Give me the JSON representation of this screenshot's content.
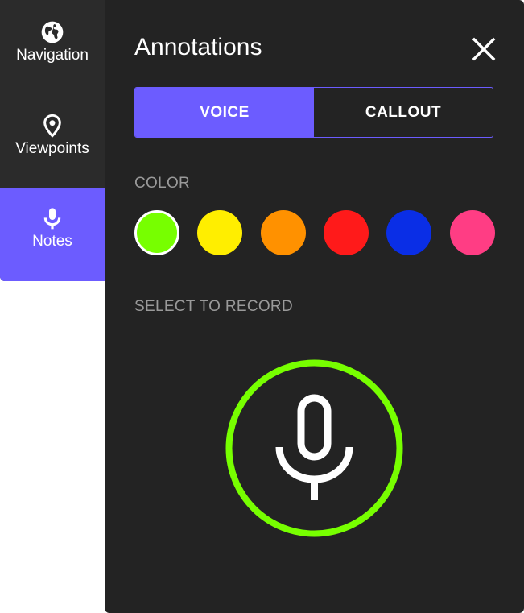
{
  "sidebar": {
    "items": [
      {
        "label": "Navigation",
        "icon": "globe-icon"
      },
      {
        "label": "Viewpoints",
        "icon": "location-pin-icon"
      },
      {
        "label": "Notes",
        "icon": "microphone-icon",
        "active": true
      }
    ],
    "active_color": "#6c5cff"
  },
  "panel": {
    "title": "Annotations",
    "close_icon": "close-icon",
    "tabs": [
      {
        "label": "VOICE",
        "active": true
      },
      {
        "label": "CALLOUT",
        "active": false
      }
    ],
    "color_label": "COLOR",
    "colors": [
      {
        "name": "green",
        "hex": "#77ff00",
        "selected": true
      },
      {
        "name": "yellow",
        "hex": "#ffee00",
        "selected": false
      },
      {
        "name": "orange",
        "hex": "#ff9100",
        "selected": false
      },
      {
        "name": "red",
        "hex": "#ff1a1a",
        "selected": false
      },
      {
        "name": "blue",
        "hex": "#0a2ee6",
        "selected": false
      },
      {
        "name": "pink",
        "hex": "#ff3d84",
        "selected": false
      }
    ],
    "record_label": "SELECT TO RECORD",
    "record_icon": "microphone-icon",
    "record_ring_color": "#77ff00"
  }
}
